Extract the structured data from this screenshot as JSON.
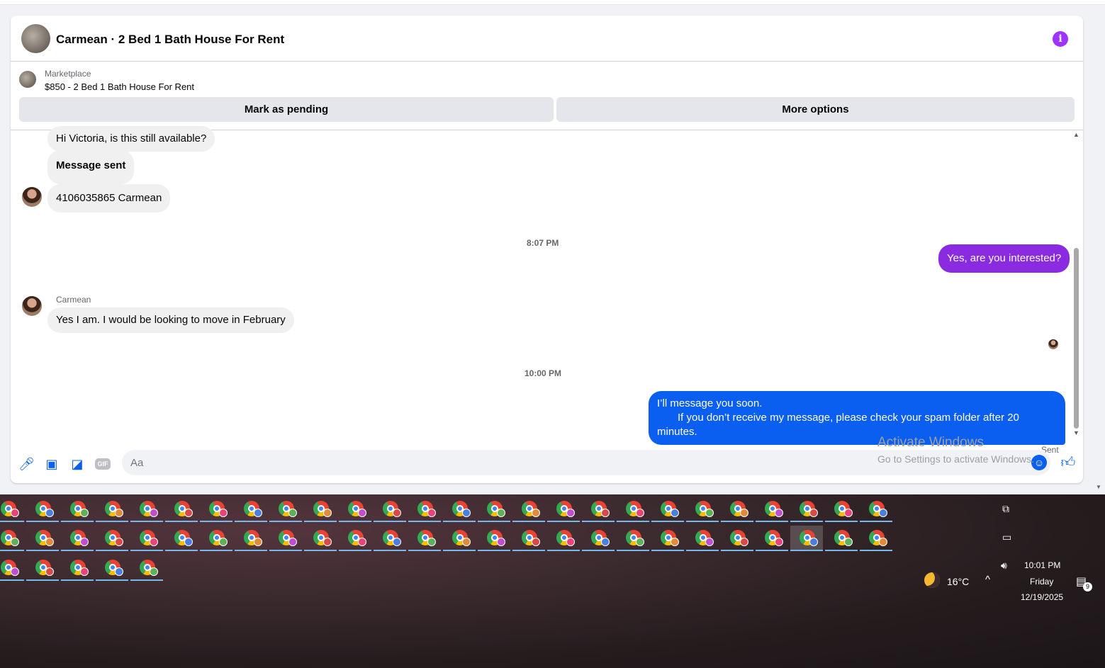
{
  "chat": {
    "title": "Carmean · 2 Bed 1 Bath House For Rent",
    "info_icon": "info-icon",
    "info_color": "#a033ff"
  },
  "listing": {
    "source": "Marketplace",
    "price_title": "$850 - 2 Bed 1 Bath House For Rent",
    "mark_pending_label": "Mark as pending",
    "more_options_label": "More options"
  },
  "messages": [
    {
      "direction": "incoming",
      "text": "Hi Victoria, is this still available?"
    },
    {
      "direction": "incoming",
      "text": "Message sent"
    },
    {
      "direction": "incoming",
      "text": "4106035865 Carmean"
    },
    {
      "direction": "timestamp",
      "text": "8:07 PM"
    },
    {
      "direction": "outgoing",
      "text": "Yes, are you interested?"
    },
    {
      "direction": "sender",
      "text": "Carmean"
    },
    {
      "direction": "incoming",
      "text": "Yes I am. I would be looking to move in February"
    },
    {
      "direction": "timestamp",
      "text": "10:00 PM"
    },
    {
      "direction": "outgoing",
      "text": "I’ll message you soon.",
      "text2": "If you don’t receive my message, please check your spam folder after 20 minutes."
    }
  ],
  "message_status": "Sent",
  "composer": {
    "placeholder": "Aa",
    "icons": [
      "microphone-icon",
      "photo-icon",
      "sticker-icon",
      "gif-icon",
      "emoji-icon",
      "thumbs-up-icon"
    ],
    "gif_label": "GIF"
  },
  "watermark": {
    "title": "Activate Windows",
    "subtitle": "Go to Settings to activate Windows."
  },
  "colors": {
    "outgoing_purple": "#8a2be2",
    "outgoing_blue": "#0a5ef0",
    "incoming_bubble": "#f0f0f0"
  },
  "taskbar": {
    "app_icon": "chrome-icon",
    "row_counts": [
      26,
      26,
      5
    ],
    "weather_temp": "16°C",
    "clock_time": "10:01 PM",
    "clock_day": "Friday",
    "clock_date": "12/19/2025",
    "notification_count": "9"
  }
}
